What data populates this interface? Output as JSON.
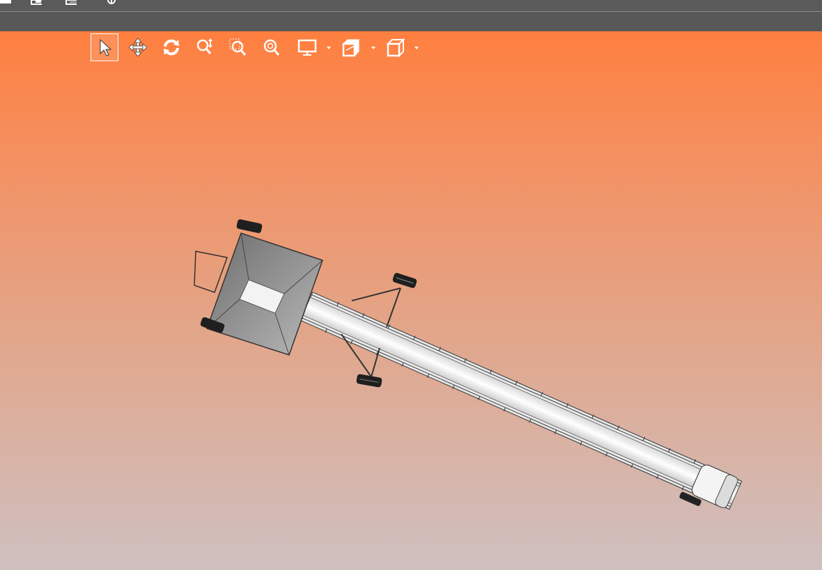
{
  "app": {
    "top_toolbar": {
      "icons": [
        "folder-icon",
        "save-icon",
        "print-icon",
        "settings-icon"
      ]
    },
    "view_toolbar": {
      "buttons": [
        {
          "name": "select-tool-button",
          "icon": "cursor-arrow-icon",
          "active": true
        },
        {
          "name": "pan-tool-button",
          "icon": "move-arrows-icon"
        },
        {
          "name": "rotate-tool-button",
          "icon": "rotate-icon"
        },
        {
          "name": "zoom-tool-button",
          "icon": "zoom-icon"
        },
        {
          "name": "zoom-window-button",
          "icon": "zoom-window-icon"
        },
        {
          "name": "zoom-fit-button",
          "icon": "zoom-fit-icon"
        },
        {
          "name": "display-mode-button",
          "icon": "monitor-icon",
          "dropdown": true
        },
        {
          "name": "section-view-button",
          "icon": "section-cube-icon",
          "dropdown": true
        },
        {
          "name": "standard-views-button",
          "icon": "cube-icon",
          "dropdown": true
        }
      ]
    },
    "viewport": {
      "background_top": "#ff7f3f",
      "background_bottom": "#cfc0c0",
      "model": "conveyor-with-hopper"
    }
  }
}
